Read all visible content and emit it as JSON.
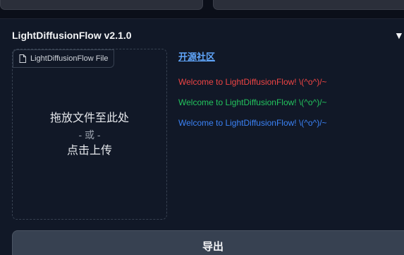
{
  "panel": {
    "title": "LightDiffusionFlow v2.1.0",
    "collapse_glyph": "▼"
  },
  "upload": {
    "file_label": "LightDiffusionFlow File",
    "drop_line1": "拖放文件至此处",
    "drop_or": "- 或 -",
    "drop_line2": "点击上传"
  },
  "links": {
    "community": "开源社区"
  },
  "messages": [
    {
      "text": "Welcome to LightDiffusionFlow! \\(^o^)/~",
      "color": "#ef4444"
    },
    {
      "text": "Welcome to LightDiffusionFlow! \\(^o^)/~",
      "color": "#22c55e"
    },
    {
      "text": "Welcome to LightDiffusionFlow! \\(^o^)/~",
      "color": "#3b82f6"
    }
  ],
  "actions": {
    "export_label": "导出"
  },
  "icons": {
    "file": "file-icon",
    "collapse": "triangle-down-icon"
  }
}
